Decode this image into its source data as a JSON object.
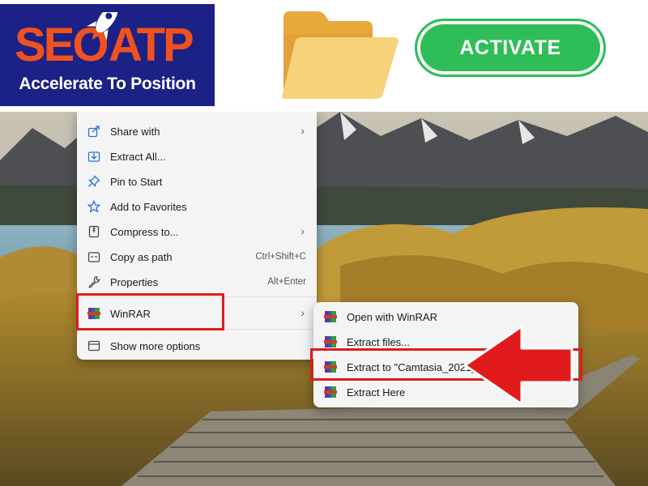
{
  "banner": {
    "logo_text": "SEOATP",
    "logo_tagline": "Accelerate To Position",
    "activate_label": "ACTIVATE",
    "colors": {
      "logo_bg": "#1c2185",
      "logo_orange": "#f0521f",
      "button_green": "#2fbd57",
      "folder_yellow": "#f6d27a"
    }
  },
  "context_menu": {
    "items": [
      {
        "label": "Share with",
        "icon": "share-icon",
        "shortcut": "",
        "submenu": true
      },
      {
        "label": "Extract All...",
        "icon": "extract-all-icon",
        "shortcut": "",
        "submenu": false
      },
      {
        "label": "Pin to Start",
        "icon": "pin-icon",
        "shortcut": "",
        "submenu": false
      },
      {
        "label": "Add to Favorites",
        "icon": "star-icon",
        "shortcut": "",
        "submenu": false
      },
      {
        "label": "Compress to...",
        "icon": "compress-icon",
        "shortcut": "",
        "submenu": true
      },
      {
        "label": "Copy as path",
        "icon": "copy-path-icon",
        "shortcut": "Ctrl+Shift+C",
        "submenu": false
      },
      {
        "label": "Properties",
        "icon": "wrench-icon",
        "shortcut": "Alt+Enter",
        "submenu": false
      },
      {
        "label": "WinRAR",
        "icon": "winrar-icon",
        "shortcut": "",
        "submenu": true
      },
      {
        "label": "Show more options",
        "icon": "more-options-icon",
        "shortcut": "",
        "submenu": false
      }
    ]
  },
  "winrar_submenu": {
    "items": [
      {
        "label": "Open with WinRAR"
      },
      {
        "label": "Extract files..."
      },
      {
        "label": "Extract to \"Camtasia_2021_"
      },
      {
        "label": "Extract Here"
      }
    ]
  },
  "annotations": {
    "highlight_color": "#e11b1b"
  }
}
